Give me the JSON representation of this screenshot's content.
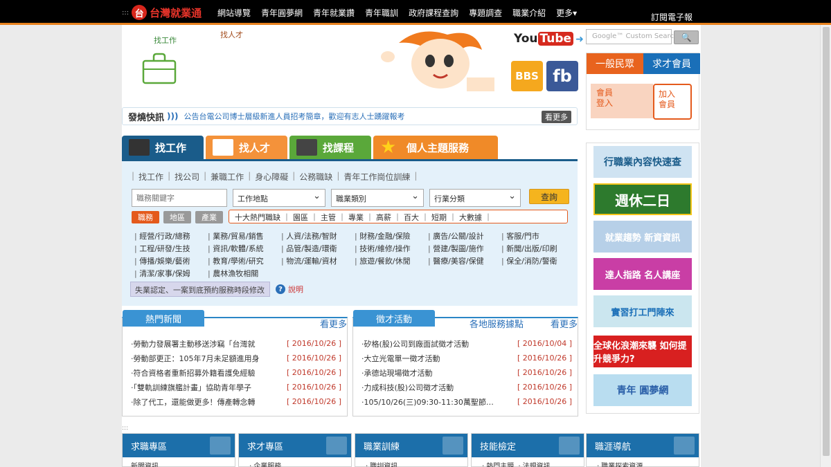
{
  "header": {
    "logo_text": "台灣就業通",
    "logo_mark": "台",
    "nav": [
      "網站導覽",
      "青年圓夢網",
      "青年就業讚",
      "青年職訓",
      "政府課程查詢",
      "專題調查",
      "職業介紹",
      "更多▾"
    ],
    "subscribe": "訂閱電子報"
  },
  "top": {
    "find_job": "找工作",
    "find_talent": "找人才",
    "youtube_a": "You",
    "youtube_b": "Tube",
    "bbs": "BBS",
    "fb": "fb"
  },
  "news_flash": {
    "label": "發燒快訊",
    "message": "公告台電公司博士層級新進人員招考簡章，歡迎有志人士踴躍報考",
    "more": "看更多"
  },
  "main_tabs": [
    "找工作",
    "找人才",
    "找課程",
    "個人主題服務"
  ],
  "search": {
    "subnav": [
      "找工作",
      "找公司",
      "兼職工作",
      "身心障礙",
      "公務職缺",
      "青年工作崗位訓練"
    ],
    "keyword_placeholder": "職務關鍵字",
    "location": "工作地點",
    "job_type": "職業類別",
    "industry": "行業分類",
    "query": "查詢",
    "pills": [
      "職務",
      "地區",
      "產業"
    ],
    "hot": "十大熱門職缺 ｜ 園區 ｜ 主管 ｜ 專業 ｜ 高薪 ｜ 百大 ｜ 短期 ｜ 大數據 ｜",
    "categories": [
      [
        "經營/行政/總務",
        "業務/貿易/銷售",
        "人資/法務/智財",
        "財務/金融/保險",
        "廣告/公關/設計",
        "客服/門市"
      ],
      [
        "工程/研發/生技",
        "資訊/軟體/系統",
        "品管/製造/環衛",
        "技術/維修/操作",
        "營建/製圖/施作",
        "新聞/出版/印刷"
      ],
      [
        "傳播/娛樂/藝術",
        "教育/學術/研究",
        "物流/運輸/資材",
        "旅遊/餐飲/休閒",
        "醫療/美容/保健",
        "保全/消防/警衛"
      ],
      [
        "清潔/家事/保姆",
        "農林漁牧相關"
      ]
    ],
    "cert_text": "失業認定、一案到底預約服務時段修改",
    "help": "說明"
  },
  "hot_news": {
    "title": "熱門新聞",
    "more": "看更多",
    "items": [
      {
        "t": "·勞動力發展署主動移送涉竊「台灣就",
        "d": "[ 2016/10/26 ]"
      },
      {
        "t": "·勞動部更正：105年7月未足額進用身",
        "d": "[ 2016/10/26 ]"
      },
      {
        "t": "·符合資格者重新招募外籍看護免經驗",
        "d": "[ 2016/10/26 ]"
      },
      {
        "t": "·「雙軌訓練旗艦計畫」協助青年學子",
        "d": "[ 2016/10/26 ]"
      },
      {
        "t": "·除了代工，還能做更多！傳產轉念轉",
        "d": "[ 2016/10/26 ]"
      }
    ]
  },
  "recruit": {
    "title": "徵才活動",
    "service": "各地服務據點",
    "more": "看更多",
    "items": [
      {
        "t": "·矽格(股)公司到廠面試徵才活動",
        "d": "[ 2016/10/04 ]"
      },
      {
        "t": "·大立光電單一徵才活動",
        "d": "[ 2016/10/26 ]"
      },
      {
        "t": "·承德站現場徵才活動",
        "d": "[ 2016/10/26 ]"
      },
      {
        "t": "·力成科技(股)公司徵才活動",
        "d": "[ 2016/10/26 ]"
      },
      {
        "t": "·105/10/26(三)09:30-11:30萬聖節…",
        "d": "[ 2016/10/26 ]"
      }
    ]
  },
  "bottom_cards": [
    {
      "title": "求職專區",
      "sub": "新聞資訊"
    },
    {
      "title": "求才專區",
      "sub": "ㆍ企業服務"
    },
    {
      "title": "職業訓練",
      "sub": "ㆍ職訓資訊"
    },
    {
      "title": "技能檢定",
      "sub": "ㆍ熱門主題    ㆍ法規資訊"
    },
    {
      "title": "職涯導航",
      "sub": "ㆍ職業探索資源"
    }
  ],
  "sidebar": {
    "search_placeholder": "Google™ Custom Search",
    "search_btn": "🔍",
    "tab_public": "一般民眾",
    "tab_member": "求才會員",
    "login": "會員\n登入",
    "join": "加入\n會員",
    "banners": [
      "行職業內容快速查",
      "週休二日",
      "就業趨勢 新資資訊",
      "達人指路 名人講座",
      "實習打工門陣來",
      "全球化浪潮來襲 如何提升競爭力?",
      "青年 圓夢網"
    ]
  }
}
